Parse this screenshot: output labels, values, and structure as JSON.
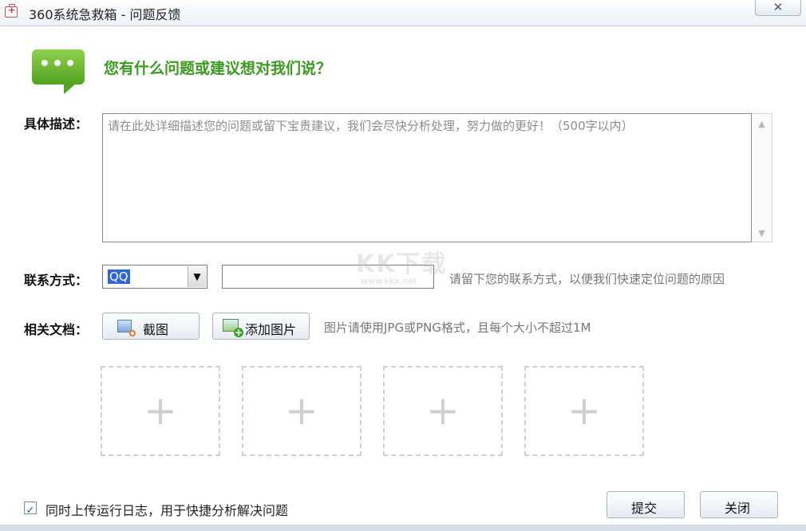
{
  "window": {
    "title": "360系统急救箱 - 问题反馈",
    "close_label": "✕"
  },
  "header": {
    "bubble_dots": "•••",
    "heading": "您有什么问题或建议想对我们说？"
  },
  "description": {
    "label": "具体描述：",
    "placeholder": "请在此处详细描述您的问题或留下宝贵建议，我们会尽快分析处理，努力做的更好！（500字以内）",
    "scroll_up": "▲",
    "scroll_down": "▼"
  },
  "contact": {
    "label": "联系方式：",
    "selected_type": "QQ",
    "arrow": "▼",
    "value": "",
    "hint": "请留下您的联系方式，以便我们快速定位问题的原因"
  },
  "documents": {
    "label": "相关文档：",
    "screenshot_label": "截图",
    "add_image_label": "添加图片",
    "hint": "图片请使用JPG或PNG格式，且每个大小不超过1M",
    "slots": [
      "+",
      "+",
      "+",
      "+"
    ]
  },
  "footer": {
    "upload_log_checked": true,
    "check_mark": "✓",
    "upload_log_label": "同时上传运行日志，用于快捷分析解决问题",
    "submit_label": "提交",
    "close_label": "关闭"
  },
  "watermark": {
    "logo": "KK下载",
    "url": "www.kkx.net"
  }
}
